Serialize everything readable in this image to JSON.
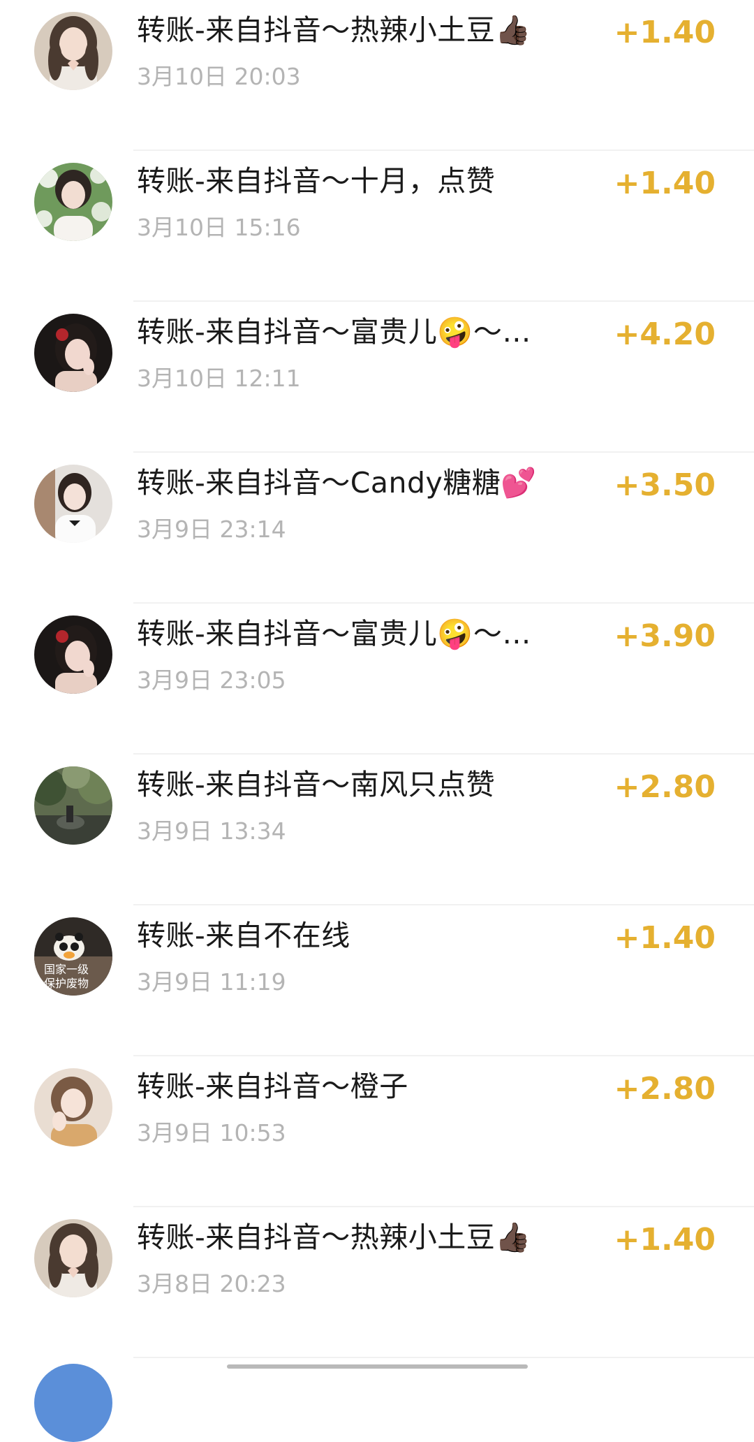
{
  "transactions": [
    {
      "title": "转账-来自抖音～热辣小土豆👍🏿",
      "time": "3月10日 20:03",
      "amount": "+1.40",
      "avatar_icon": "avatar-photo-heart-hands"
    },
    {
      "title": "转账-来自抖音～十月，点赞",
      "time": "3月10日 15:16",
      "amount": "+1.40",
      "avatar_icon": "avatar-photo-girl-flowers"
    },
    {
      "title": "转账-来自抖音～富贵儿🤪～…",
      "time": "3月10日 12:11",
      "amount": "+4.20",
      "avatar_icon": "avatar-photo-girl-red-flower"
    },
    {
      "title": "转账-来自抖音～Candy糖糖💕",
      "time": "3月9日 23:14",
      "amount": "+3.50",
      "avatar_icon": "avatar-photo-girl-white-shirt"
    },
    {
      "title": "转账-来自抖音～富贵儿🤪～…",
      "time": "3月9日 23:05",
      "amount": "+3.90",
      "avatar_icon": "avatar-photo-girl-red-flower"
    },
    {
      "title": "转账-来自抖音～南风只点赞",
      "time": "3月9日 13:34",
      "amount": "+2.80",
      "avatar_icon": "avatar-photo-garden-scene"
    },
    {
      "title": "转账-来自不在线",
      "time": "3月9日 11:19",
      "amount": "+1.40",
      "avatar_icon": "avatar-photo-panda-text"
    },
    {
      "title": "转账-来自抖音～橙子",
      "time": "3月9日 10:53",
      "amount": "+2.80",
      "avatar_icon": "avatar-photo-girl-blonde"
    },
    {
      "title": "转账-来自抖音～热辣小土豆👍🏿",
      "time": "3月8日 20:23",
      "amount": "+1.40",
      "avatar_icon": "avatar-photo-heart-hands"
    }
  ],
  "avatar_panda_text": [
    "国家一级",
    "保护废物"
  ],
  "colors": {
    "amount": "#e5b030",
    "title": "#1a1a1a",
    "time": "#b4b4b4",
    "divider": "#f1f1f1"
  }
}
